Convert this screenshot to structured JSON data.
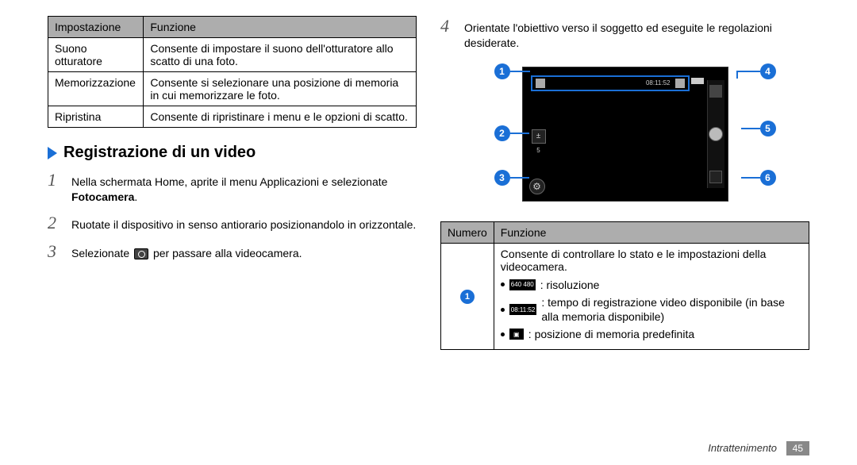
{
  "table1": {
    "headers": [
      "Impostazione",
      "Funzione"
    ],
    "rows": [
      [
        "Suono otturatore",
        "Consente di impostare il suono dell'otturatore allo scatto di una foto."
      ],
      [
        "Memorizzazione",
        "Consente si selezionare una posizione di memoria in cui memorizzare le foto."
      ],
      [
        "Ripristina",
        "Consente di ripristinare i menu e le opzioni di scatto."
      ]
    ]
  },
  "section_title": "Registrazione di un video",
  "steps": {
    "s1_a": "Nella schermata Home, aprite il menu Applicazioni e selezionate ",
    "s1_b": "Fotocamera",
    "s1_c": ".",
    "s2": "Ruotate il dispositivo in senso antiorario posizionandolo in orizzontale.",
    "s3_a": "Selezionate ",
    "s3_b": " per passare alla videocamera.",
    "s4": "Orientate l'obiettivo verso il soggetto ed eseguite le regolazioni desiderate."
  },
  "diagram": {
    "status_time": "08:11:52",
    "exposure_glyph": "±",
    "exposure_val": "5",
    "settings_glyph": "⚙",
    "badges": {
      "b1": "1",
      "b2": "2",
      "b3": "3",
      "b4": "4",
      "b5": "5",
      "b6": "6"
    }
  },
  "table2": {
    "headers": [
      "Numero",
      "Funzione"
    ],
    "row1": {
      "badge": "1",
      "intro": "Consente di controllare lo stato e le impostazioni della videocamera.",
      "items": {
        "res_label": "640 480",
        "res_text": " : risoluzione",
        "time_label": "08:11:52",
        "time_text": " : tempo di registrazione video disponibile (in base alla memoria disponibile)",
        "mem_text": " : posizione di memoria predefinita"
      }
    }
  },
  "footer": {
    "section": "Intrattenimento",
    "page": "45"
  }
}
